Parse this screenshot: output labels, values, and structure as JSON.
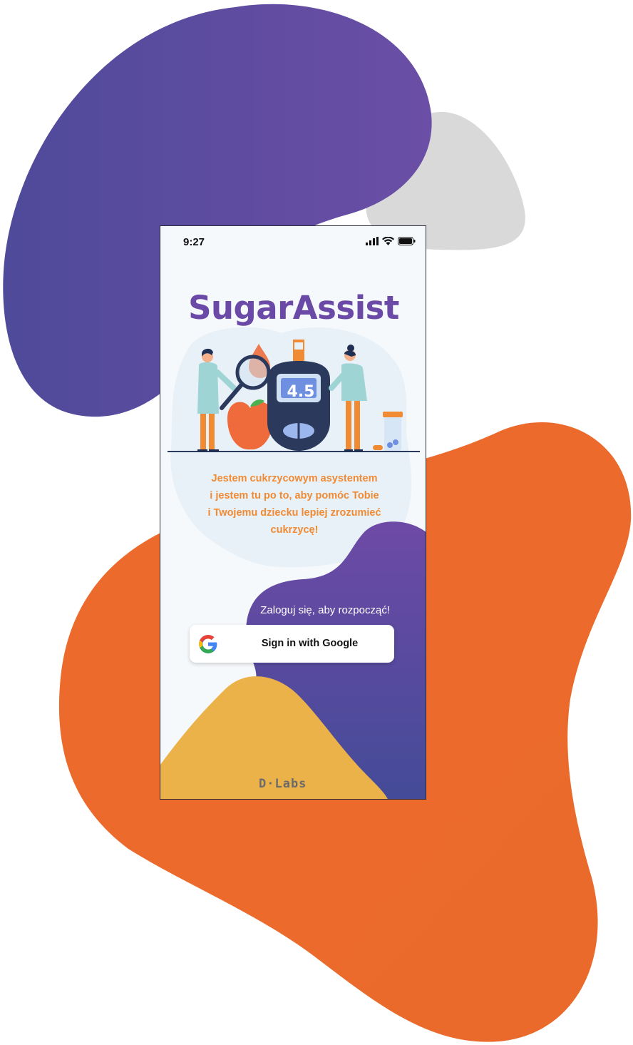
{
  "status_bar": {
    "time": "9:27"
  },
  "app": {
    "title": "SugarAssist"
  },
  "illustration": {
    "meter_reading": "4.5"
  },
  "intro": {
    "lines": [
      "Jestem cukrzycowym asystentem",
      "i jestem tu po to, aby pomóc Tobie",
      "i Twojemu dziecku lepiej zrozumieć",
      "cukrzycę!"
    ]
  },
  "login": {
    "prompt": "Zaloguj się, aby rozpocząć!",
    "google_button_label": "Sign in with Google"
  },
  "footer": {
    "brand": "D·Labs"
  },
  "colors": {
    "purple": "#6a4aa6",
    "orange": "#ea6d2c",
    "yellow": "#ebb24a",
    "gray": "#d9d9d9",
    "intro_text": "#f08a33"
  }
}
